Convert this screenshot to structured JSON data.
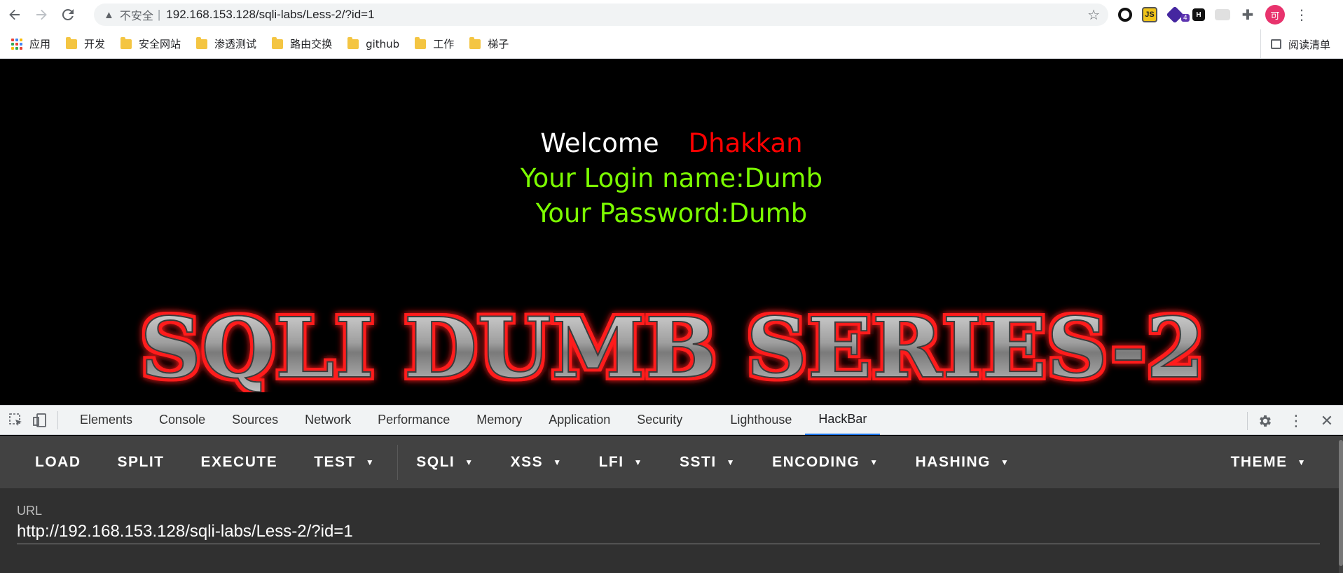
{
  "browser": {
    "security_label": "不安全",
    "address": "192.168.153.128/sqli-labs/Less-2/?id=1",
    "avatar_text": "可",
    "extension_badge": "4",
    "ext_js_label": "JS",
    "ext_h_label": "H"
  },
  "bookmarks": {
    "apps": "应用",
    "items": [
      "开发",
      "安全网站",
      "渗透测试",
      "路由交换",
      "github",
      "工作",
      "梯子"
    ],
    "reading_list": "阅读清单"
  },
  "page": {
    "welcome": "Welcome",
    "user_name": "Dhakkan",
    "login_line": "Your Login name:Dumb",
    "password_line": "Your Password:Dumb",
    "banner": "SQLI DUMB SERIES-2"
  },
  "devtools": {
    "tabs": [
      "Elements",
      "Console",
      "Sources",
      "Network",
      "Performance",
      "Memory",
      "Application",
      "Security",
      "Lighthouse",
      "HackBar"
    ],
    "active_tab": "HackBar"
  },
  "hackbar": {
    "buttons": [
      "LOAD",
      "SPLIT",
      "EXECUTE"
    ],
    "test": "TEST",
    "menus": [
      "SQLI",
      "XSS",
      "LFI",
      "SSTI",
      "ENCODING",
      "HASHING"
    ],
    "theme": "THEME",
    "url_label": "URL",
    "url_value": "http://192.168.153.128/sqli-labs/Less-2/?id=1"
  },
  "colors": {
    "welcome_name": "#ff0000",
    "login_text": "#7cfc00",
    "active_tab_underline": "#1a73e8",
    "hackbar_toolbar": "#424242"
  }
}
